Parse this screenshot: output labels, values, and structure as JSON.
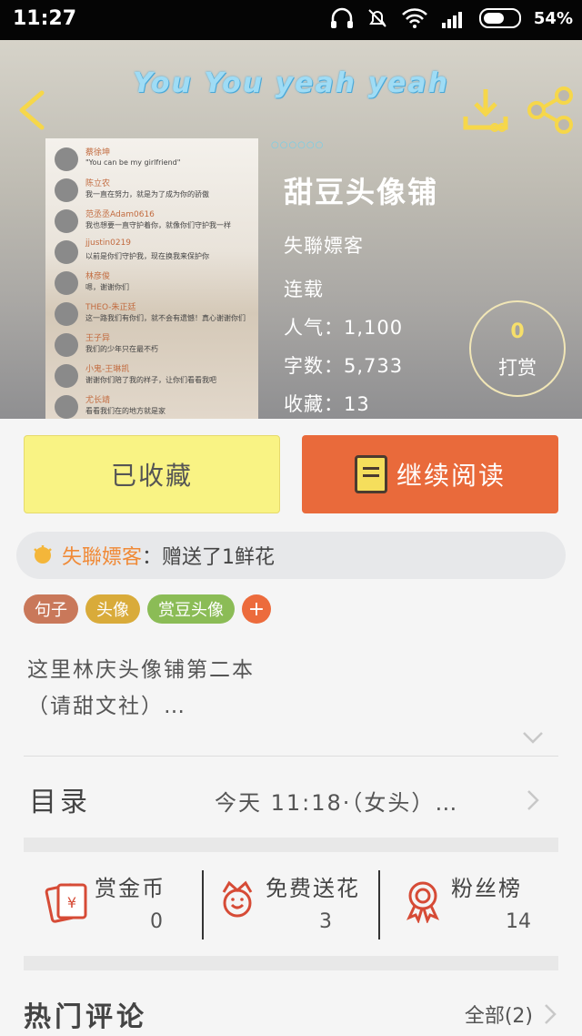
{
  "status_bar": {
    "time": "11:27",
    "battery": "54%"
  },
  "header": {
    "title": "You You yeah yeah",
    "book_title": "甜豆头像铺",
    "author": "失聯嫖客",
    "state": "连载",
    "popularity": "人气：1,100",
    "word_count": "字数：5,733",
    "favorites": "收藏：13",
    "tip_count": "0",
    "tip_label": "打赏",
    "dots": "○○○○○○"
  },
  "cover": {
    "rows": [
      {
        "name": "蔡徐坤",
        "msg": "\"You can be my girlfriend\""
      },
      {
        "name": "陈立农",
        "msg": "我一直在努力，就是为了成为你的骄傲"
      },
      {
        "name": "范丞丞Adam0616",
        "msg": "我也想要一直守护着你，就像你们守护我一样"
      },
      {
        "name": "jjustin0219",
        "msg": "以前是你们守护我，现在换我来保护你"
      },
      {
        "name": "林彦俊",
        "msg": "嗯，谢谢你们"
      },
      {
        "name": "THEO-朱正廷",
        "msg": "这一路我们有你们，就不会有遗憾！真心谢谢你们"
      },
      {
        "name": "王子异",
        "msg": "我们的少年只在最不朽"
      },
      {
        "name": "小鬼-王琳凯",
        "msg": "谢谢你们陪了我的样子，让你们看看我吧"
      },
      {
        "name": "尤长靖",
        "msg": "看看我们在的地方就是家"
      }
    ]
  },
  "actions": {
    "favorited_label": "已收藏",
    "continue_label": "继续阅读"
  },
  "gift": {
    "user": "失聯嫖客",
    "text": "：赠送了1鲜花"
  },
  "tags": [
    {
      "label": "句子",
      "color": "#c9785a"
    },
    {
      "label": "头像",
      "color": "#d9ab3a"
    },
    {
      "label": "赏豆头像",
      "color": "#8bbc56"
    }
  ],
  "tag_add": "+",
  "description": {
    "line1": "这里林庆头像铺第二本",
    "line2": "（请甜文社）…"
  },
  "toc": {
    "label": "目录",
    "latest": "今天 11:18·（女头）…"
  },
  "stats": [
    {
      "label": "赏金币",
      "value": "0"
    },
    {
      "label": "免费送花",
      "value": "3"
    },
    {
      "label": "粉丝榜",
      "value": "14"
    }
  ],
  "hot_comments": {
    "label": "热门评论",
    "all": "全部(2)"
  },
  "colors": {
    "accent_orange": "#e96a3b",
    "fav_yellow": "#f9f384",
    "title_blue": "#9fdcf5"
  }
}
